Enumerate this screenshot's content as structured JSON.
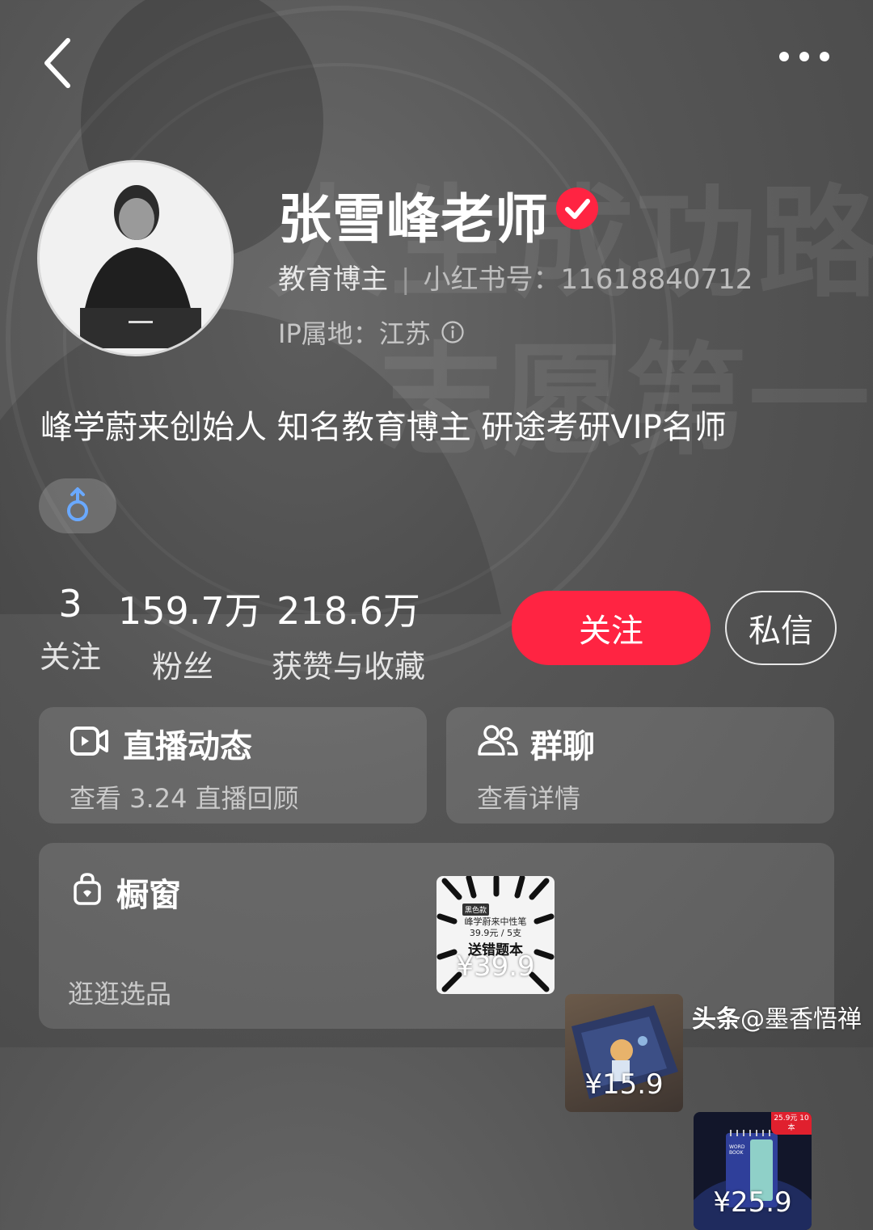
{
  "header": {
    "back_icon": "chevron-left-icon",
    "more_icon": "more-horizontal-icon"
  },
  "background": {
    "line1": "人生成功路",
    "line2": "志愿第一步"
  },
  "profile": {
    "name": "张雪峰老师",
    "verified_icon": "verified-check-icon",
    "role": "教育博主",
    "separator": "|",
    "red_id": "小红书号：11618840712",
    "ip": "IP属地：江苏",
    "ip_info_icon": "info-icon",
    "bio": "峰学蔚来创始人 知名教育博主 研途考研VIP名师",
    "gender_icon": "male-icon"
  },
  "stats": [
    {
      "value": "3",
      "label": "关注"
    },
    {
      "value": "159.7万",
      "label": "粉丝"
    },
    {
      "value": "218.6万",
      "label": "获赞与收藏"
    }
  ],
  "actions": {
    "follow_label": "关注",
    "message_label": "私信"
  },
  "cards": {
    "live": {
      "icon": "video-icon",
      "title": "直播动态",
      "subtitle": "查看 3.24 直播回顾"
    },
    "group": {
      "icon": "group-users-icon",
      "title": "群聊",
      "subtitle": "查看详情"
    }
  },
  "shop": {
    "icon": "shopping-bag-icon",
    "title": "橱窗",
    "subtitle": "逛逛选品",
    "products": [
      {
        "price": "¥39.9",
        "badge": "黑色款",
        "line1": "峰学蔚来中性笔",
        "line2": "39.9元 / 5支",
        "line3": "送错题本"
      },
      {
        "price": "¥15.9"
      },
      {
        "price": "¥25.9",
        "corner_tag": "25.9元 10本",
        "book_label": "WORD BOOK"
      }
    ]
  },
  "watermark": {
    "platform": "头条",
    "handle": "@墨香悟禅"
  },
  "colors": {
    "accent": "#ff2442",
    "gender": "#6aa9ff"
  }
}
